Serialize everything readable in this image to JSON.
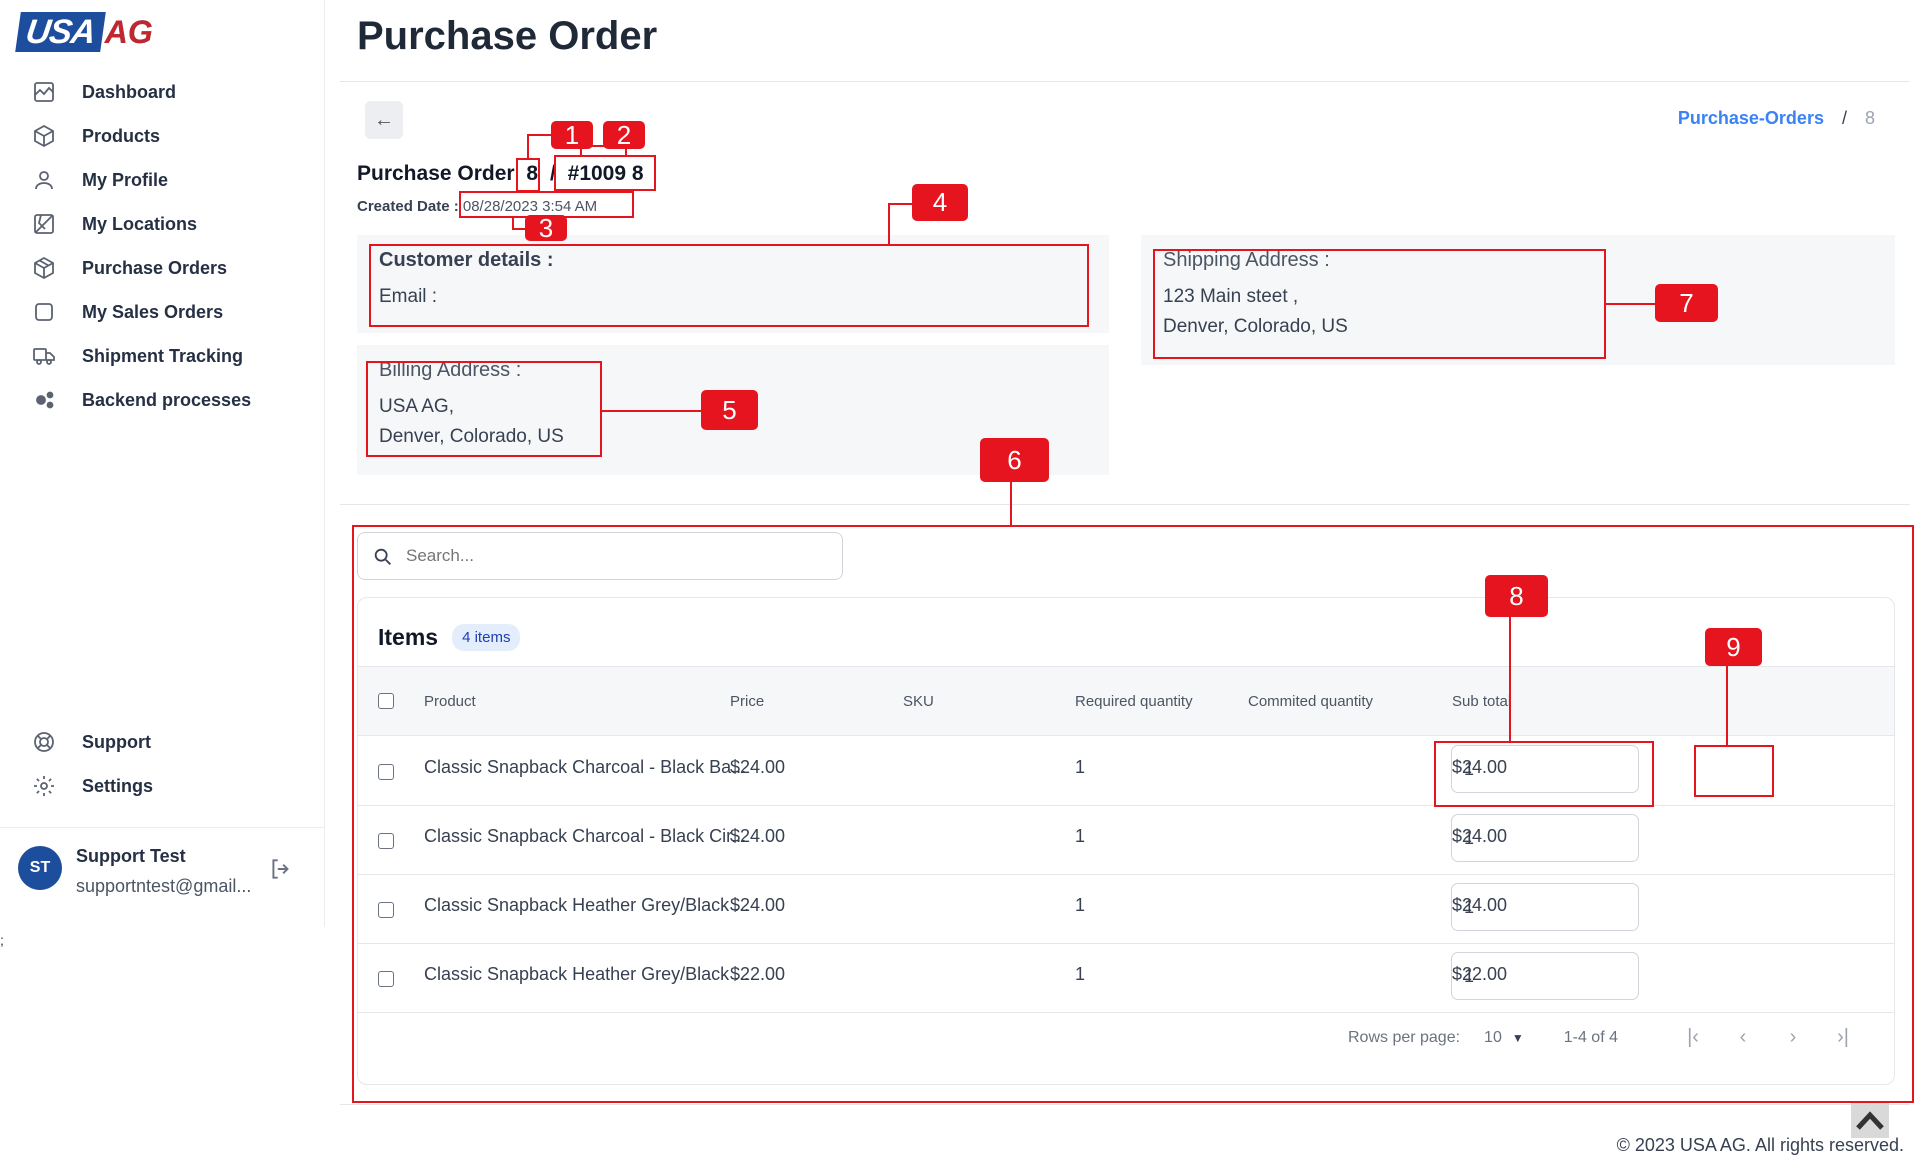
{
  "brand": {
    "logo_left": "USA",
    "logo_right": "AG"
  },
  "nav": [
    {
      "label": "Dashboard",
      "icon": "chart-icon"
    },
    {
      "label": "Products",
      "icon": "box-icon"
    },
    {
      "label": "My Profile",
      "icon": "user-icon"
    },
    {
      "label": "My Locations",
      "icon": "map-icon"
    },
    {
      "label": "Purchase Orders",
      "icon": "package-icon"
    },
    {
      "label": "My Sales Orders",
      "icon": "square-icon"
    },
    {
      "label": "Shipment Tracking",
      "icon": "truck-icon"
    },
    {
      "label": "Backend processes",
      "icon": "gears-icon"
    }
  ],
  "nav_bottom": [
    {
      "label": "Support",
      "icon": "lifebuoy-icon"
    },
    {
      "label": "Settings",
      "icon": "gear-icon"
    }
  ],
  "user": {
    "initials": "ST",
    "name": "Support Test",
    "email": "supportntest@gmail..."
  },
  "stray_text": ";",
  "page": {
    "title": "Purchase Order",
    "breadcrumb": {
      "link": "Purchase-Orders",
      "sep": "/",
      "current": "8"
    },
    "po_label": "Purchase Order",
    "po_id": "8",
    "po_slash": "/",
    "po_number": "#1009 8",
    "created_label": "Created Date :",
    "created_value": "08/28/2023 3:54 AM"
  },
  "customer": {
    "heading": "Customer details :",
    "email_label": "Email :"
  },
  "billing": {
    "heading": "Billing Address :",
    "line1": "USA AG,",
    "line2": "Denver, Colorado, US"
  },
  "shipping": {
    "heading": "Shipping Address :",
    "line1": "123 Main steet ,",
    "line2": "Denver, Colorado, US"
  },
  "search": {
    "placeholder": "Search..."
  },
  "items": {
    "title": "Items",
    "badge": "4 items",
    "columns": [
      "Product",
      "Price",
      "SKU",
      "Required quantity",
      "Commited quantity",
      "Sub total"
    ],
    "rows": [
      {
        "product": "Classic Snapback Charcoal - Black Ba...",
        "price": "$24.00",
        "sku": "",
        "required": "1",
        "committed": "1",
        "subtotal": "$24.00"
      },
      {
        "product": "Classic Snapback Charcoal - Black Cir...",
        "price": "$24.00",
        "sku": "",
        "required": "1",
        "committed": "1",
        "subtotal": "$24.00"
      },
      {
        "product": "Classic Snapback Heather Grey/Black ...",
        "price": "$24.00",
        "sku": "",
        "required": "1",
        "committed": "1",
        "subtotal": "$24.00"
      },
      {
        "product": "Classic Snapback Heather Grey/Black ...",
        "price": "$22.00",
        "sku": "",
        "required": "1",
        "committed": "1",
        "subtotal": "$22.00"
      }
    ]
  },
  "pagination": {
    "rows_label": "Rows per page:",
    "rows_value": "10",
    "range": "1-4 of 4"
  },
  "footer": "© 2023 USA AG. All rights reserved.",
  "annotations": [
    "1",
    "2",
    "3",
    "4",
    "5",
    "6",
    "7",
    "8",
    "9"
  ],
  "colors": {
    "brand_blue": "#1d4e9e",
    "brand_red": "#c1272d",
    "annotation_red": "#e5141f",
    "link_blue": "#3b82f6"
  }
}
